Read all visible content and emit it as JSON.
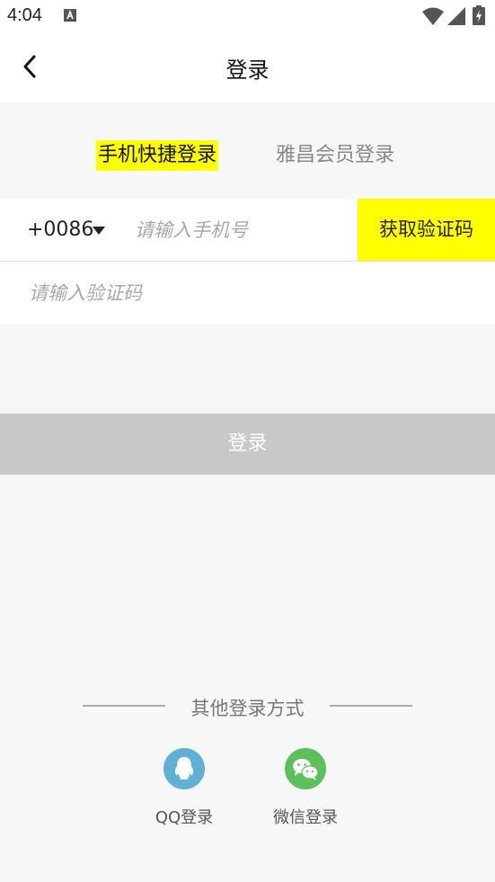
{
  "statusbar": {
    "time": "4:04"
  },
  "header": {
    "title": "登录"
  },
  "tabs": {
    "quick_login": "手机快捷登录",
    "member_login": "雅昌会员登录"
  },
  "phone_row": {
    "country_code": "+0086",
    "phone_placeholder": "请输入手机号",
    "get_code_label": "获取验证码"
  },
  "code_row": {
    "code_placeholder": "请输入验证码"
  },
  "login_button": {
    "label": "登录"
  },
  "other_login": {
    "title": "其他登录方式",
    "qq_label": "QQ登录",
    "wechat_label": "微信登录"
  },
  "colors": {
    "accent_yellow": "#ffff00",
    "login_disabled": "#c8c8c8",
    "qq_icon": "#5fb0d3",
    "wechat_icon": "#5dc15a"
  }
}
